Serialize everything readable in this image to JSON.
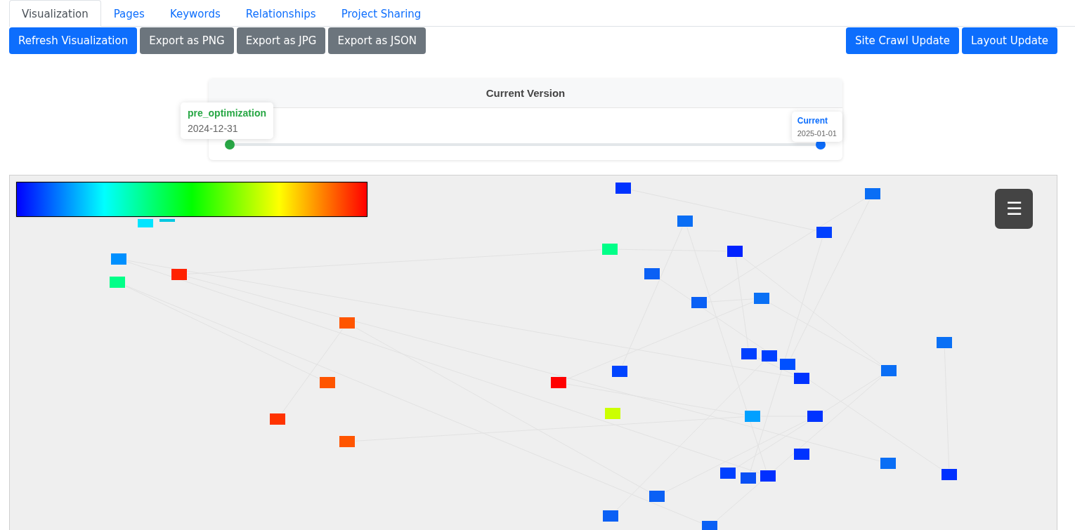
{
  "tabs": [
    {
      "label": "Visualization",
      "selected": true
    },
    {
      "label": "Pages",
      "selected": false
    },
    {
      "label": "Keywords",
      "selected": false
    },
    {
      "label": "Relationships",
      "selected": false
    },
    {
      "label": "Project Sharing",
      "selected": false
    }
  ],
  "toolbar": {
    "left_buttons": [
      {
        "label": "Refresh Visualization",
        "kind": "primary"
      },
      {
        "label": "Export as PNG",
        "kind": "secondary"
      },
      {
        "label": "Export as JPG",
        "kind": "secondary"
      },
      {
        "label": "Export as JSON",
        "kind": "secondary"
      }
    ],
    "right_buttons": [
      {
        "label": "Site Crawl Update",
        "kind": "primary"
      },
      {
        "label": "Layout Update",
        "kind": "primary"
      }
    ]
  },
  "version_panel": {
    "title": "Current Version",
    "versions": [
      {
        "name": "pre_optimization",
        "date": "2024-12-31",
        "color": "#28a745"
      },
      {
        "name": "Current",
        "date": "2025-01-01",
        "color": "#0d6efd"
      }
    ]
  },
  "graph": {
    "menu_button": "☰",
    "nodes": [
      {
        "color": "#0033ff"
      },
      {
        "color": "#0a6ef5"
      },
      {
        "color": "#00e5ff"
      },
      {
        "color": "#00c8e0"
      },
      {
        "color": "#0a6ef5"
      },
      {
        "color": "#0040ff"
      },
      {
        "color": "#00ff88"
      },
      {
        "color": "#0022ff"
      },
      {
        "color": "#0090ff"
      },
      {
        "color": "#ff2200"
      },
      {
        "color": "#00ff88"
      },
      {
        "color": "#0a60f5"
      },
      {
        "color": "#0a60f5"
      },
      {
        "color": "#0a70f5"
      },
      {
        "color": "#ff5500"
      },
      {
        "color": "#0a70f5"
      },
      {
        "color": "#0040ff"
      },
      {
        "color": "#0040ff"
      },
      {
        "color": "#0050ff"
      },
      {
        "color": "#0044ff"
      },
      {
        "color": "#0a6ef5"
      },
      {
        "color": "#ff5500"
      },
      {
        "color": "#ff0000"
      },
      {
        "color": "#0033ff"
      },
      {
        "color": "#ccff00"
      },
      {
        "color": "#00a0ff"
      },
      {
        "color": "#0033ff"
      },
      {
        "color": "#ff3300"
      },
      {
        "color": "#ff5500"
      },
      {
        "color": "#0033ff"
      },
      {
        "color": "#0a6ef5"
      },
      {
        "color": "#0040ff"
      },
      {
        "color": "#0a50f5"
      },
      {
        "color": "#0030ff"
      },
      {
        "color": "#0030ff"
      },
      {
        "color": "#0a60f5"
      },
      {
        "color": "#0a60f5"
      },
      {
        "color": "#0a60f5"
      }
    ]
  }
}
